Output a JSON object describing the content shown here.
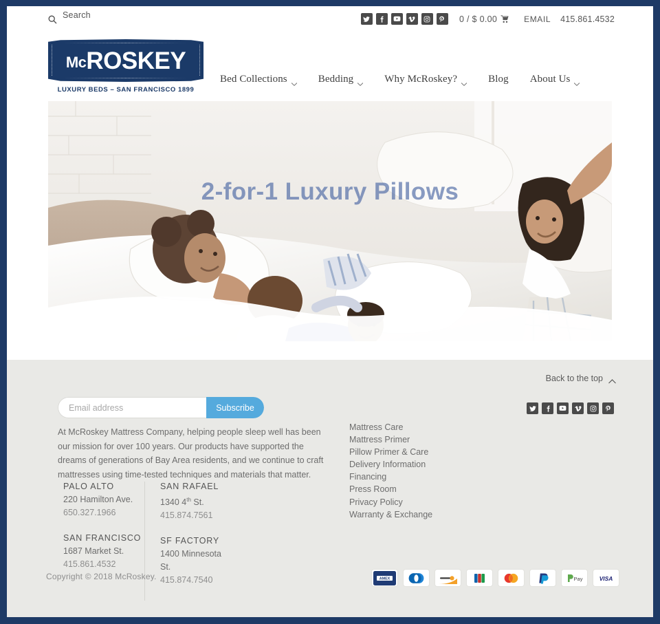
{
  "theme": {
    "frame_color": "#1e3a66",
    "logo_navy": "#1b3a68",
    "subscribe_blue": "#55aadd",
    "footer_gray": "#e9e9e6",
    "hero_title_color": "#4060a0"
  },
  "utility_bar": {
    "search_placeholder": "Search",
    "search_label": "Search",
    "social": [
      {
        "name": "twitter-icon",
        "label": "Twitter"
      },
      {
        "name": "facebook-icon",
        "label": "Facebook"
      },
      {
        "name": "youtube-icon",
        "label": "YouTube"
      },
      {
        "name": "vimeo-icon",
        "label": "Vimeo"
      },
      {
        "name": "instagram-icon",
        "label": "Instagram"
      },
      {
        "name": "pinterest-icon",
        "label": "Pinterest"
      }
    ],
    "cart_text": "0 / $ 0.00",
    "email_label": "EMAIL",
    "phone": "415.861.4532"
  },
  "logo": {
    "word_mc": "Mc",
    "word_rest": "ROSKEY",
    "tagline": "LUXURY BEDS – SAN FRANCISCO 1899"
  },
  "nav": {
    "items": [
      {
        "label": "Bed Collections",
        "has_caret": true
      },
      {
        "label": "Bedding",
        "has_caret": true
      },
      {
        "label": "Why McRoskey?",
        "has_caret": true
      },
      {
        "label": "Blog",
        "has_caret": false
      },
      {
        "label": "About Us",
        "has_caret": true
      }
    ]
  },
  "hero": {
    "title": "2-for-1 Luxury Pillows",
    "description": "Photo of children having a pillow fight on a white bed"
  },
  "footer": {
    "back_to_top": "Back to the top",
    "newsletter": {
      "placeholder": "Email address",
      "value": "",
      "subscribe_label": "Subscribe"
    },
    "about_text": "At McRoskey Mattress Company, helping people sleep well has been our mission for over 100 years. Our products have supported the dreams of generations of Bay Area residents, and we continue to craft mattresses using time-tested techniques and materials that matter.",
    "addresses": [
      [
        {
          "city": "PALO ALTO",
          "street": "220 Hamilton Ave.",
          "street_sup": "",
          "street_tail": "",
          "phone": "650.327.1966"
        },
        {
          "city": "SAN FRANCISCO",
          "street": "1687 Market St.",
          "street_sup": "",
          "street_tail": "",
          "phone": "415.861.4532"
        }
      ],
      [
        {
          "city": "SAN RAFAEL",
          "street": "1340 4",
          "street_sup": "th",
          "street_tail": " St.",
          "phone": "415.874.7561"
        },
        {
          "city": "SF FACTORY",
          "street": "1400 Minnesota St.",
          "street_sup": "",
          "street_tail": "",
          "phone": "415.874.7540"
        }
      ]
    ],
    "links": [
      "Mattress Care",
      "Mattress Primer",
      "Pillow Primer & Care",
      "Delivery Information",
      "Financing",
      "Press Room",
      "Privacy Policy",
      "Warranty & Exchange"
    ],
    "social": [
      {
        "name": "twitter-icon",
        "label": "Twitter"
      },
      {
        "name": "facebook-icon",
        "label": "Facebook"
      },
      {
        "name": "youtube-icon",
        "label": "YouTube"
      },
      {
        "name": "vimeo-icon",
        "label": "Vimeo"
      },
      {
        "name": "instagram-icon",
        "label": "Instagram"
      },
      {
        "name": "pinterest-icon",
        "label": "Pinterest"
      }
    ],
    "copyright": "Copyright © 2018 McRoskey.",
    "payments": [
      {
        "name": "amex-icon",
        "label": "AMEX"
      },
      {
        "name": "diners-club-icon",
        "label": "Diners Club"
      },
      {
        "name": "discover-icon",
        "label": "Discover"
      },
      {
        "name": "jcb-icon",
        "label": "JCB"
      },
      {
        "name": "mastercard-icon",
        "label": "Mastercard"
      },
      {
        "name": "paypal-icon",
        "label": "PayPal"
      },
      {
        "name": "google-pay-icon",
        "label": "Pay"
      },
      {
        "name": "visa-icon",
        "label": "VISA"
      }
    ]
  }
}
